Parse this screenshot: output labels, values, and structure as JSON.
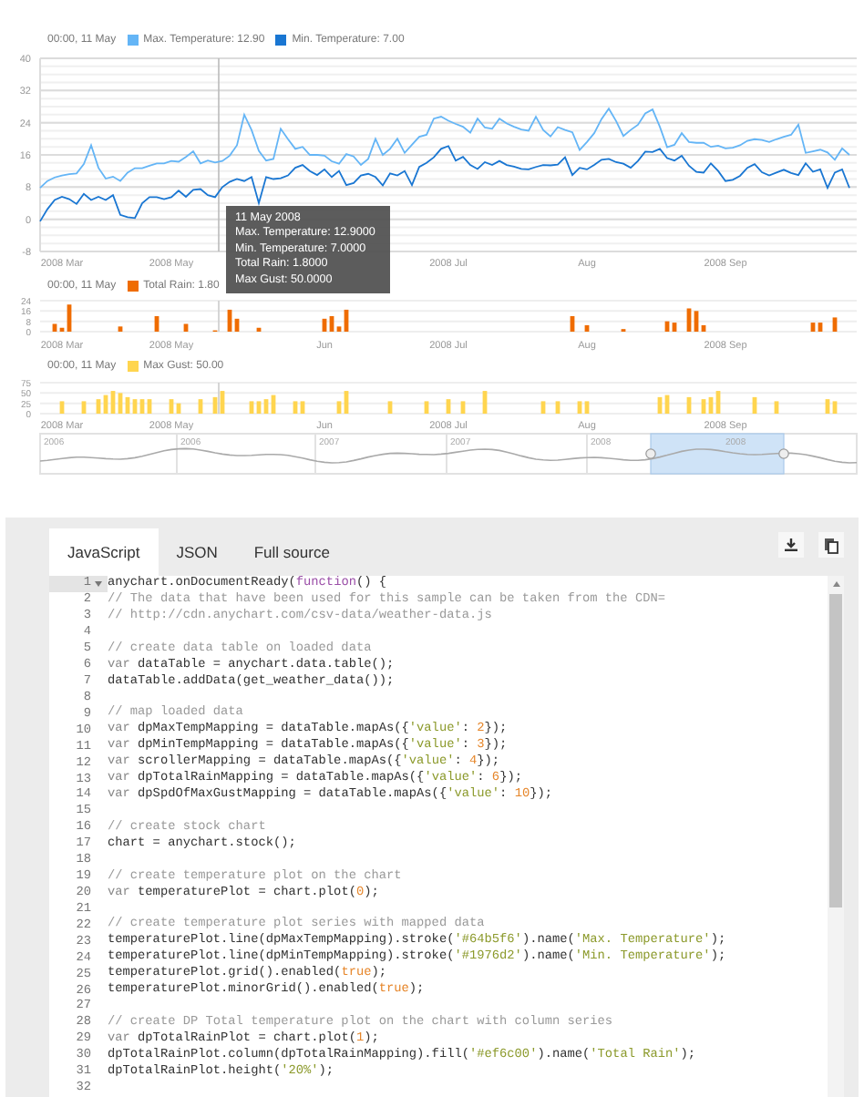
{
  "temperature_plot": {
    "legend": {
      "time": "00:00, 11 May",
      "items": [
        {
          "label": "Max. Temperature: 12.90",
          "color": "#64b5f6"
        },
        {
          "label": "Min. Temperature: 7.00",
          "color": "#1976d2"
        }
      ]
    },
    "chart_data": {
      "type": "line",
      "grid": true,
      "ylim": [
        -8,
        40
      ],
      "yticks": [
        -8,
        0,
        8,
        16,
        24,
        32,
        40
      ],
      "categories": [
        null,
        null,
        null,
        "2008 Mar",
        null,
        null,
        null,
        null,
        null,
        null,
        null,
        null,
        null,
        null,
        null,
        null,
        null,
        null,
        "2008 May",
        null,
        null,
        null,
        null,
        null,
        null,
        null,
        null,
        null,
        null,
        null,
        null,
        null,
        null,
        null,
        null,
        null,
        null,
        null,
        null,
        null,
        null,
        null,
        null,
        null,
        null,
        null,
        null,
        null,
        null,
        null,
        null,
        null,
        null,
        null,
        null,
        null,
        "2008 Jul",
        null,
        null,
        null,
        null,
        null,
        null,
        null,
        null,
        null,
        null,
        null,
        null,
        null,
        null,
        null,
        null,
        null,
        null,
        "Aug",
        null,
        null,
        null,
        null,
        null,
        null,
        null,
        null,
        null,
        null,
        null,
        null,
        null,
        null,
        null,
        null,
        null,
        null,
        "2008 Sep",
        null,
        null,
        null,
        null,
        null,
        null,
        null,
        null,
        null,
        null,
        null,
        null,
        null,
        null,
        null,
        null,
        null
      ],
      "series": [
        {
          "color": "#64b5f6",
          "values": [
            7.8,
            9.5,
            10.4,
            10.9,
            11.2,
            11.4,
            13.7,
            18.4,
            12.8,
            10.1,
            10.6,
            9.5,
            11.6,
            12.7,
            12.7,
            13.3,
            13.9,
            13.9,
            14.5,
            14.3,
            15.5,
            16.9,
            13.9,
            14.6,
            14.1,
            14.5,
            15.8,
            18.4,
            26,
            22.2,
            17,
            14.6,
            15,
            22.5,
            19.9,
            17.5,
            18,
            16,
            16,
            15.8,
            14.4,
            13.8,
            16.2,
            15.6,
            13.5,
            15,
            20,
            16,
            17.5,
            20,
            16.5,
            18.5,
            20.5,
            21,
            25,
            25.5,
            24.5,
            23.7,
            23,
            21.5,
            25,
            22.8,
            22.5,
            25,
            23.8,
            23,
            22.3,
            22,
            25.5,
            22.2,
            20.6,
            22.9,
            22.2,
            21.6,
            17.2,
            19.2,
            21.4,
            24.9,
            27.5,
            24.4,
            20.7,
            22.2,
            23.5,
            26.3,
            27.3,
            23,
            17.9,
            18.5,
            21.4,
            19.2,
            19,
            19,
            18,
            18.3,
            17.6,
            17.8,
            18.4,
            19.5,
            19.9,
            19.7,
            19.2,
            19.9,
            20.5,
            21,
            23.5,
            16.5,
            16.9,
            17.3,
            16.6,
            14.8,
            17.6,
            16
          ]
        },
        {
          "color": "#1976d2",
          "values": [
            -0.5,
            2.5,
            4.8,
            5.6,
            5,
            3.8,
            6.3,
            4.8,
            5.6,
            4.8,
            6,
            1.1,
            0.5,
            0.3,
            4,
            5.5,
            5.5,
            5,
            5.5,
            7.1,
            5.6,
            7.3,
            7.5,
            6,
            5.5,
            8,
            9.3,
            10,
            9.5,
            10.5,
            4,
            10.5,
            10,
            10.2,
            10.9,
            12.8,
            13.5,
            12,
            11,
            12.4,
            10.5,
            12,
            8.5,
            9,
            10.9,
            11.3,
            10.5,
            8.4,
            11.4,
            10.9,
            12,
            8.5,
            13,
            14,
            15.4,
            17.5,
            18.2,
            14.6,
            15.5,
            13.5,
            12.5,
            14.2,
            13.5,
            14.5,
            13.5,
            13.1,
            12.5,
            12.4,
            13,
            13.5,
            13.4,
            13.6,
            15.4,
            11,
            12.8,
            12.4,
            13.5,
            14.8,
            15,
            14.2,
            13.8,
            12.8,
            14.5,
            16.8,
            16.7,
            17.5,
            15.2,
            14.6,
            15.8,
            13.3,
            11.8,
            11.6,
            13.9,
            12,
            9.5,
            9.8,
            10.8,
            12.8,
            13.7,
            11.7,
            10.9,
            11.6,
            12.3,
            11.5,
            11,
            13.9,
            11.8,
            12.4,
            7.8,
            11.6,
            12.4,
            7.8
          ]
        }
      ]
    }
  },
  "rain_plot": {
    "legend": {
      "time": "00:00, 11 May",
      "items": [
        {
          "label": "Total Rain: 1.80",
          "color": "#ef6c00"
        }
      ]
    },
    "chart_data": {
      "type": "bar",
      "grid": true,
      "ylim": [
        0,
        24
      ],
      "yticks": [
        0,
        8,
        16,
        24
      ],
      "categories": [
        null,
        null,
        null,
        "2008 Mar",
        null,
        null,
        null,
        null,
        null,
        null,
        null,
        null,
        null,
        null,
        null,
        null,
        null,
        null,
        "2008 May",
        null,
        null,
        null,
        null,
        null,
        null,
        null,
        null,
        null,
        null,
        null,
        null,
        null,
        null,
        null,
        null,
        null,
        null,
        null,
        null,
        "Jun",
        null,
        null,
        null,
        null,
        null,
        null,
        null,
        null,
        null,
        null,
        null,
        null,
        null,
        null,
        null,
        null,
        "2008 Jul",
        null,
        null,
        null,
        null,
        null,
        null,
        null,
        null,
        null,
        null,
        null,
        null,
        null,
        null,
        null,
        null,
        null,
        null,
        "Aug",
        null,
        null,
        null,
        null,
        null,
        null,
        null,
        null,
        null,
        null,
        null,
        null,
        null,
        null,
        null,
        null,
        null,
        null,
        "2008 Sep",
        null,
        null,
        null,
        null,
        null,
        null,
        null,
        null,
        null,
        null,
        null,
        null,
        null,
        null,
        null,
        null,
        null
      ],
      "series": [
        {
          "color": "#ef6c00",
          "values": [
            null,
            null,
            6,
            3,
            21,
            null,
            null,
            null,
            null,
            null,
            null,
            4,
            null,
            null,
            null,
            null,
            12,
            null,
            null,
            null,
            6,
            null,
            null,
            null,
            1,
            null,
            17,
            10,
            null,
            null,
            3,
            null,
            null,
            null,
            null,
            null,
            null,
            null,
            null,
            10,
            12,
            4,
            17,
            null,
            null,
            null,
            null,
            null,
            null,
            null,
            null,
            null,
            null,
            null,
            null,
            null,
            null,
            null,
            null,
            null,
            null,
            null,
            null,
            null,
            null,
            null,
            null,
            null,
            null,
            null,
            null,
            null,
            null,
            12,
            null,
            5,
            null,
            null,
            null,
            null,
            2,
            null,
            null,
            null,
            null,
            null,
            8,
            7,
            null,
            18,
            16,
            5,
            null,
            null,
            null,
            null,
            null,
            null,
            null,
            null,
            null,
            null,
            null,
            null,
            null,
            null,
            7,
            7,
            null,
            11,
            null,
            null
          ]
        }
      ]
    }
  },
  "gust_plot": {
    "legend": {
      "time": "00:00, 11 May",
      "items": [
        {
          "label": "Max Gust: 50.00",
          "color": "#ffd54f"
        }
      ]
    },
    "chart_data": {
      "type": "bar",
      "grid": true,
      "ylim": [
        0,
        75
      ],
      "yticks": [
        0,
        25,
        50,
        75
      ],
      "categories": [
        null,
        null,
        null,
        "2008 Mar",
        null,
        null,
        null,
        null,
        null,
        null,
        null,
        null,
        null,
        null,
        null,
        null,
        null,
        null,
        "2008 May",
        null,
        null,
        null,
        null,
        null,
        null,
        null,
        null,
        null,
        null,
        null,
        null,
        null,
        null,
        null,
        null,
        null,
        null,
        null,
        null,
        "Jun",
        null,
        null,
        null,
        null,
        null,
        null,
        null,
        null,
        null,
        null,
        null,
        null,
        null,
        null,
        null,
        null,
        "2008 Jul",
        null,
        null,
        null,
        null,
        null,
        null,
        null,
        null,
        null,
        null,
        null,
        null,
        null,
        null,
        null,
        null,
        null,
        null,
        "Aug",
        null,
        null,
        null,
        null,
        null,
        null,
        null,
        null,
        null,
        null,
        null,
        null,
        null,
        null,
        null,
        null,
        null,
        null,
        "2008 Sep",
        null,
        null,
        null,
        null,
        null,
        null,
        null,
        null,
        null,
        null,
        null,
        null,
        null,
        null,
        null,
        null,
        null
      ],
      "series": [
        {
          "color": "#ffd54f",
          "values": [
            null,
            null,
            null,
            30,
            null,
            null,
            30,
            null,
            35,
            45,
            55,
            50,
            40,
            35,
            35,
            35,
            null,
            null,
            35,
            25,
            null,
            null,
            35,
            null,
            40,
            55,
            null,
            null,
            null,
            30,
            30,
            35,
            45,
            null,
            null,
            30,
            30,
            null,
            null,
            null,
            null,
            30,
            55,
            null,
            null,
            null,
            null,
            null,
            30,
            null,
            null,
            null,
            null,
            30,
            null,
            null,
            35,
            null,
            30,
            null,
            null,
            55,
            null,
            null,
            null,
            null,
            null,
            null,
            null,
            30,
            null,
            30,
            null,
            null,
            30,
            30,
            null,
            null,
            null,
            null,
            null,
            null,
            null,
            null,
            null,
            40,
            45,
            null,
            null,
            40,
            null,
            35,
            40,
            55,
            null,
            null,
            null,
            null,
            40,
            null,
            null,
            30,
            null,
            null,
            null,
            null,
            null,
            null,
            35,
            30,
            null,
            null
          ]
        }
      ]
    }
  },
  "scroller": {
    "labels": [
      "2006",
      "2006",
      "2007",
      "2007",
      "2008",
      "2008"
    ]
  },
  "tooltip": {
    "title": "11 May 2008",
    "lines": [
      "Max. Temperature: 12.9000",
      "Min. Temperature: 7.0000",
      "Total Rain: 1.8000",
      "Max Gust: 50.0000"
    ]
  },
  "code_panel": {
    "tabs": [
      {
        "label": "JavaScript",
        "selected": true
      },
      {
        "label": "JSON",
        "selected": false
      },
      {
        "label": "Full source",
        "selected": false
      }
    ],
    "lines": [
      {
        "number": "1",
        "active": true,
        "foldable": true,
        "tokens": [
          {
            "kind": "plain",
            "text": "anychart.onDocumentReady("
          },
          {
            "kind": "function",
            "text": "function"
          },
          {
            "kind": "plain",
            "text": "() {"
          }
        ]
      },
      {
        "number": "2",
        "tokens": [
          {
            "kind": "comment",
            "text": "// The data that have been used for this sample can be taken from the CDN="
          }
        ]
      },
      {
        "number": "3",
        "tokens": [
          {
            "kind": "comment",
            "text": "// http://cdn.anychart.com/csv-data/weather-data.js"
          }
        ]
      },
      {
        "number": "4"
      },
      {
        "number": "5",
        "tokens": [
          {
            "kind": "comment",
            "text": "// create data table on loaded data"
          }
        ]
      },
      {
        "number": "6",
        "tokens": [
          {
            "kind": "keyword",
            "text": "var"
          },
          {
            "kind": "plain",
            "text": " dataTable = anychart.data.table();"
          }
        ]
      },
      {
        "number": "7",
        "tokens": [
          {
            "kind": "plain",
            "text": "dataTable.addData(get_weather_data());"
          }
        ]
      },
      {
        "number": "8"
      },
      {
        "number": "9",
        "tokens": [
          {
            "kind": "comment",
            "text": "// map loaded data"
          }
        ]
      },
      {
        "number": "10",
        "tokens": [
          {
            "kind": "keyword",
            "text": "var"
          },
          {
            "kind": "plain",
            "text": " dpMaxTempMapping = dataTable.mapAs({"
          },
          {
            "kind": "string",
            "text": "'value'"
          },
          {
            "kind": "plain",
            "text": ": "
          },
          {
            "kind": "number",
            "text": "2"
          },
          {
            "kind": "plain",
            "text": "});"
          }
        ]
      },
      {
        "number": "11",
        "tokens": [
          {
            "kind": "keyword",
            "text": "var"
          },
          {
            "kind": "plain",
            "text": " dpMinTempMapping = dataTable.mapAs({"
          },
          {
            "kind": "string",
            "text": "'value'"
          },
          {
            "kind": "plain",
            "text": ": "
          },
          {
            "kind": "number",
            "text": "3"
          },
          {
            "kind": "plain",
            "text": "});"
          }
        ]
      },
      {
        "number": "12",
        "tokens": [
          {
            "kind": "keyword",
            "text": "var"
          },
          {
            "kind": "plain",
            "text": " scrollerMapping = dataTable.mapAs({"
          },
          {
            "kind": "string",
            "text": "'value'"
          },
          {
            "kind": "plain",
            "text": ": "
          },
          {
            "kind": "number",
            "text": "4"
          },
          {
            "kind": "plain",
            "text": "});"
          }
        ]
      },
      {
        "number": "13",
        "tokens": [
          {
            "kind": "keyword",
            "text": "var"
          },
          {
            "kind": "plain",
            "text": " dpTotalRainMapping = dataTable.mapAs({"
          },
          {
            "kind": "string",
            "text": "'value'"
          },
          {
            "kind": "plain",
            "text": ": "
          },
          {
            "kind": "number",
            "text": "6"
          },
          {
            "kind": "plain",
            "text": "});"
          }
        ]
      },
      {
        "number": "14",
        "tokens": [
          {
            "kind": "keyword",
            "text": "var"
          },
          {
            "kind": "plain",
            "text": " dpSpdOfMaxGustMapping = dataTable.mapAs({"
          },
          {
            "kind": "string",
            "text": "'value'"
          },
          {
            "kind": "plain",
            "text": ": "
          },
          {
            "kind": "number",
            "text": "10"
          },
          {
            "kind": "plain",
            "text": "});"
          }
        ]
      },
      {
        "number": "15"
      },
      {
        "number": "16",
        "tokens": [
          {
            "kind": "comment",
            "text": "// create stock chart"
          }
        ]
      },
      {
        "number": "17",
        "tokens": [
          {
            "kind": "plain",
            "text": "chart = anychart.stock();"
          }
        ]
      },
      {
        "number": "18"
      },
      {
        "number": "19",
        "tokens": [
          {
            "kind": "comment",
            "text": "// create temperature plot on the chart"
          }
        ]
      },
      {
        "number": "20",
        "tokens": [
          {
            "kind": "keyword",
            "text": "var"
          },
          {
            "kind": "plain",
            "text": " temperaturePlot = chart.plot("
          },
          {
            "kind": "number",
            "text": "0"
          },
          {
            "kind": "plain",
            "text": ");"
          }
        ]
      },
      {
        "number": "21"
      },
      {
        "number": "22",
        "tokens": [
          {
            "kind": "comment",
            "text": "// create temperature plot series with mapped data"
          }
        ]
      },
      {
        "number": "23",
        "tokens": [
          {
            "kind": "plain",
            "text": "temperaturePlot.line(dpMaxTempMapping).stroke("
          },
          {
            "kind": "string",
            "text": "'#64b5f6'"
          },
          {
            "kind": "plain",
            "text": ").name("
          },
          {
            "kind": "string",
            "text": "'Max. Temperature'"
          },
          {
            "kind": "plain",
            "text": ");"
          }
        ]
      },
      {
        "number": "24",
        "tokens": [
          {
            "kind": "plain",
            "text": "temperaturePlot.line(dpMinTempMapping).stroke("
          },
          {
            "kind": "string",
            "text": "'#1976d2'"
          },
          {
            "kind": "plain",
            "text": ").name("
          },
          {
            "kind": "string",
            "text": "'Min. Temperature'"
          },
          {
            "kind": "plain",
            "text": ");"
          }
        ]
      },
      {
        "number": "25",
        "tokens": [
          {
            "kind": "plain",
            "text": "temperaturePlot.grid().enabled("
          },
          {
            "kind": "number",
            "text": "true"
          },
          {
            "kind": "plain",
            "text": ");"
          }
        ]
      },
      {
        "number": "26",
        "tokens": [
          {
            "kind": "plain",
            "text": "temperaturePlot.minorGrid().enabled("
          },
          {
            "kind": "number",
            "text": "true"
          },
          {
            "kind": "plain",
            "text": ");"
          }
        ]
      },
      {
        "number": "27"
      },
      {
        "number": "28",
        "tokens": [
          {
            "kind": "comment",
            "text": "// create DP Total temperature plot on the chart with column series"
          }
        ]
      },
      {
        "number": "29",
        "tokens": [
          {
            "kind": "keyword",
            "text": "var"
          },
          {
            "kind": "plain",
            "text": " dpTotalRainPlot = chart.plot("
          },
          {
            "kind": "number",
            "text": "1"
          },
          {
            "kind": "plain",
            "text": ");"
          }
        ]
      },
      {
        "number": "30",
        "tokens": [
          {
            "kind": "plain",
            "text": "dpTotalRainPlot.column(dpTotalRainMapping).fill("
          },
          {
            "kind": "string",
            "text": "'#ef6c00'"
          },
          {
            "kind": "plain",
            "text": ").name("
          },
          {
            "kind": "string",
            "text": "'Total Rain'"
          },
          {
            "kind": "plain",
            "text": ");"
          }
        ]
      },
      {
        "number": "31",
        "tokens": [
          {
            "kind": "plain",
            "text": "dpTotalRainPlot.height("
          },
          {
            "kind": "string",
            "text": "'20%'"
          },
          {
            "kind": "plain",
            "text": ");"
          }
        ]
      },
      {
        "number": "32"
      }
    ]
  }
}
